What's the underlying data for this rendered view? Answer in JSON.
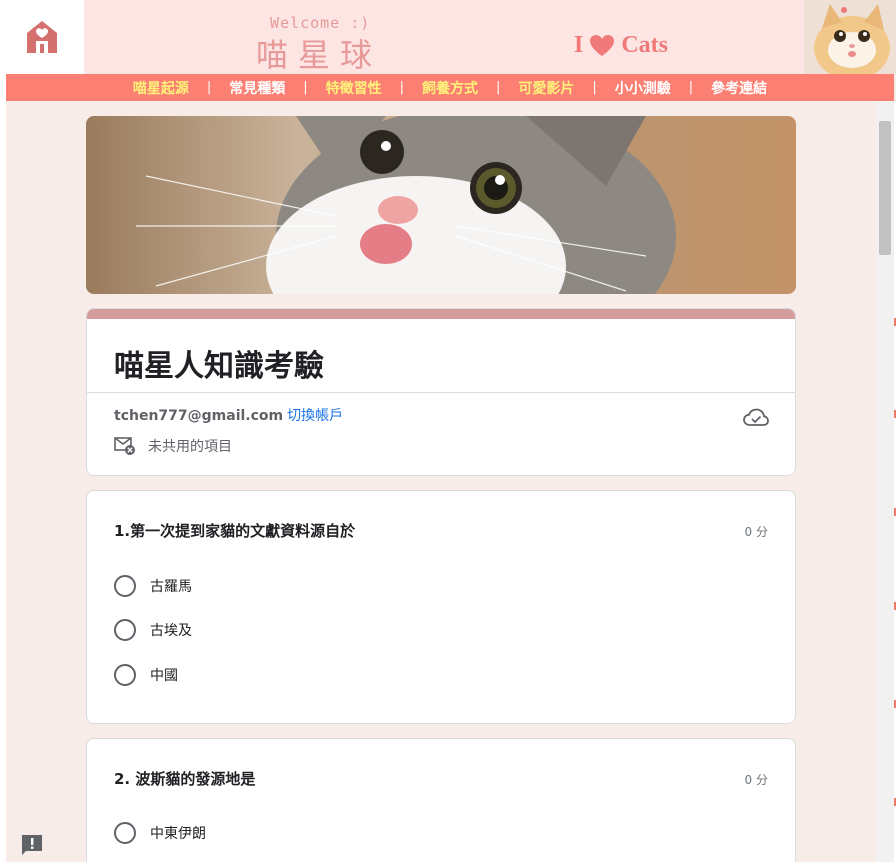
{
  "header": {
    "welcome": "Welcome :)",
    "site_title": "喵星球",
    "ilove_i": "I",
    "ilove_cats": "Cats"
  },
  "nav": {
    "items": [
      {
        "label": "喵星起源",
        "active": true
      },
      {
        "label": "常見種類",
        "active": false
      },
      {
        "label": "特徵習性",
        "active": true
      },
      {
        "label": "飼養方式",
        "active": true
      },
      {
        "label": "可愛影片",
        "active": true
      },
      {
        "label": "小小測驗",
        "active": false
      },
      {
        "label": "參考連結",
        "active": false
      }
    ]
  },
  "form": {
    "title": "喵星人知識考驗",
    "account_email": "tchen777@gmail.com",
    "switch_account": "切換帳戶",
    "not_shared": "未共用的項目"
  },
  "questions": [
    {
      "title": "1.第一次提到家貓的文獻資料源自於",
      "points": "0 分",
      "options": [
        "古羅馬",
        "古埃及",
        "中國"
      ]
    },
    {
      "title": "2. 波斯貓的發源地是",
      "points": "0 分",
      "options": [
        "中東伊朗"
      ]
    }
  ],
  "colors": {
    "nav_bg": "#fb7f72",
    "nav_active": "#fff27a",
    "header_bg": "#fde5e3",
    "page_bg": "#f8ece9",
    "title_band": "#d49c9c",
    "link": "#1a73e8"
  }
}
